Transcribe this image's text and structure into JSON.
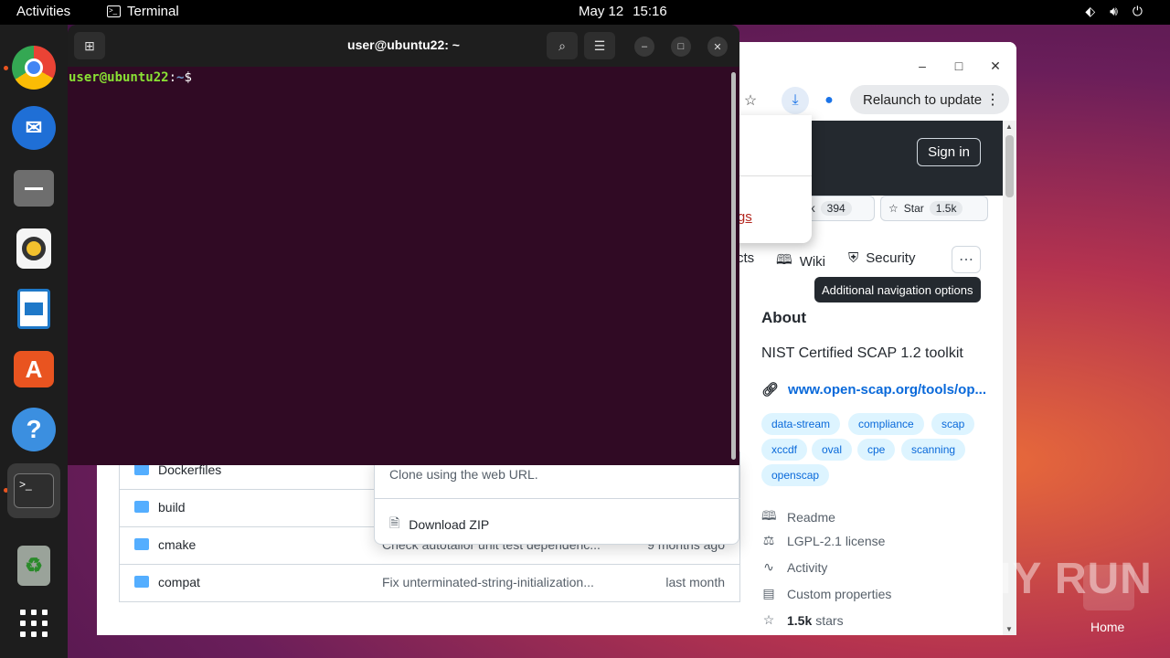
{
  "topbar": {
    "activities": "Activities",
    "app_name": "Terminal",
    "date": "May 12",
    "time": "15:16",
    "tray_icons": [
      "network-icon",
      "volume-icon",
      "power-icon"
    ]
  },
  "dock": {
    "items": [
      {
        "name": "Google Chrome",
        "icon": "chrome-icon",
        "running": true,
        "color": "#4285f4"
      },
      {
        "name": "Thunderbird",
        "icon": "thunderbird-icon",
        "running": false,
        "color": "#1f6fd6"
      },
      {
        "name": "Files",
        "icon": "files-icon",
        "running": false,
        "color": "#8a8a8a"
      },
      {
        "name": "Rhythmbox",
        "icon": "rhythmbox-icon",
        "running": false,
        "color": "#f2c12e"
      },
      {
        "name": "LibreOffice Writer",
        "icon": "writer-icon",
        "running": false,
        "color": "#1e78c8"
      },
      {
        "name": "Ubuntu Software",
        "icon": "software-icon",
        "running": false,
        "color": "#e95420"
      },
      {
        "name": "Help",
        "icon": "help-icon",
        "running": false,
        "color": "#3b8fe0"
      },
      {
        "name": "Terminal",
        "icon": "terminal-icon",
        "running": true,
        "color": "#2e2e2e"
      },
      {
        "name": "Trash",
        "icon": "trash-icon",
        "running": false,
        "color": "#9aa39a"
      },
      {
        "name": "Show Applications",
        "icon": "app-grid-icon",
        "running": false,
        "color": "#ffffff"
      }
    ]
  },
  "terminal": {
    "title": "user@ubuntu22: ~",
    "prompt_user": "user@ubuntu22",
    "prompt_sep": ":",
    "prompt_path": "~",
    "prompt_sign": "$"
  },
  "browser": {
    "relaunch_label": "Relaunch to update",
    "signin_label": "Sign in",
    "download_bubble": {
      "text_fragment": "sh",
      "link_fragment": "settings"
    },
    "fork_label_fragment": "ork",
    "fork_count": "394",
    "star_label": "Star",
    "star_count": "1.5k",
    "nav_fragment": "cts",
    "wiki_label": "Wiki",
    "security_label": "Security",
    "tooltip": "Additional navigation options",
    "about": {
      "heading": "About",
      "description": "NIST Certified SCAP 1.2 toolkit",
      "link": "www.open-scap.org/tools/op...",
      "tags": [
        "data-stream",
        "compliance",
        "scap",
        "xccdf",
        "oval",
        "cpe",
        "scanning",
        "openscap"
      ],
      "meta": [
        {
          "icon": "book-icon",
          "label": "Readme"
        },
        {
          "icon": "scale-icon",
          "label": "LGPL-2.1 license"
        },
        {
          "icon": "pulse-icon",
          "label": "Activity"
        },
        {
          "icon": "note-icon",
          "label": "Custom properties"
        },
        {
          "icon": "star-icon",
          "label_bold": "1.5k",
          "label": "stars"
        }
      ]
    },
    "clone_popup": {
      "hint": "Clone using the web URL.",
      "download_zip": "Download ZIP"
    },
    "files": [
      {
        "name": "Dockerfiles",
        "message": "",
        "date": ""
      },
      {
        "name": "build",
        "message": "",
        "date": ""
      },
      {
        "name": "cmake",
        "message": "Check autotailor unit test dependenc...",
        "date": "9 months ago"
      },
      {
        "name": "compat",
        "message": "Fix unterminated-string-initialization...",
        "date": "last month"
      }
    ]
  },
  "watermark": "ANY RUN",
  "desktop_home_label": "Home"
}
